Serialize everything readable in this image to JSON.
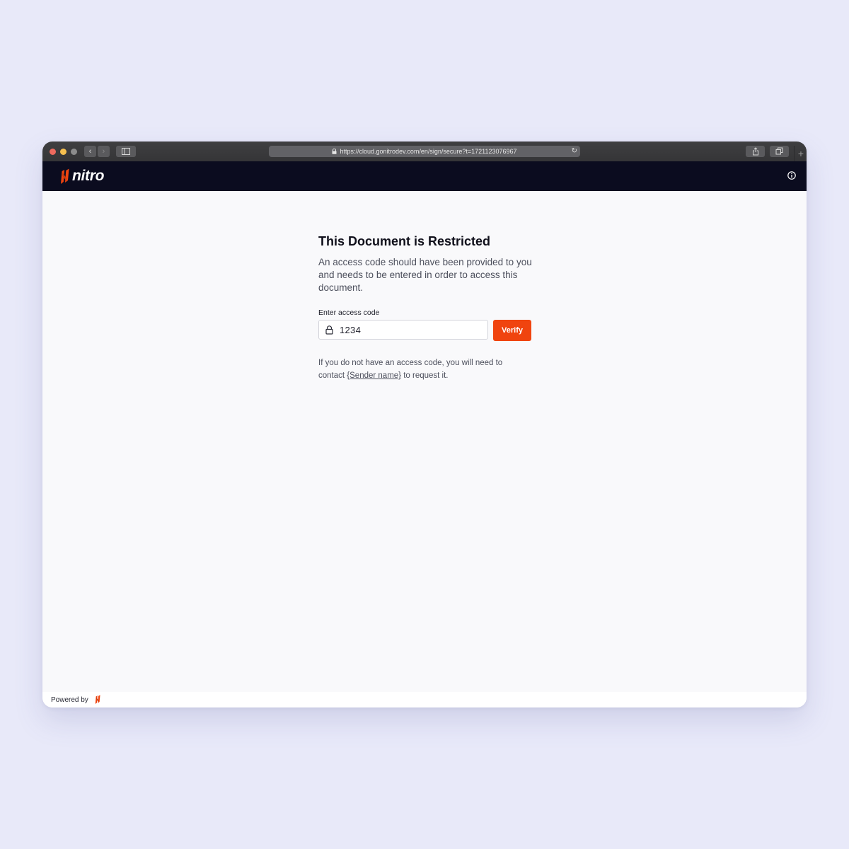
{
  "browser": {
    "url": "https://cloud.gonitrodev.com/en/sign/secure?t=1721123076967",
    "icons": {
      "back": "chevron-left-icon",
      "forward": "chevron-right-icon",
      "sidebar": "sidebar-icon",
      "lock": "lock-icon",
      "reload": "reload-icon",
      "share": "share-icon",
      "tabs": "tabs-icon",
      "new_tab": "plus-icon"
    }
  },
  "header": {
    "brand": "nitro",
    "brand_color": "#f0440f",
    "background": "#0b0c1f",
    "info_icon": "info-icon"
  },
  "main": {
    "title": "This Document is Restricted",
    "description": "An access code should have been provided to you and needs to be entered in order to access this document.",
    "field_label": "Enter access code",
    "input_value": "1234",
    "verify_label": "Verify",
    "verify_color": "#f0440f",
    "help_prefix": "If you do not have an access code, you will need to contact ",
    "sender_link": "{Sender name}",
    "help_suffix": " to request it."
  },
  "footer": {
    "powered_by": "Powered by"
  }
}
